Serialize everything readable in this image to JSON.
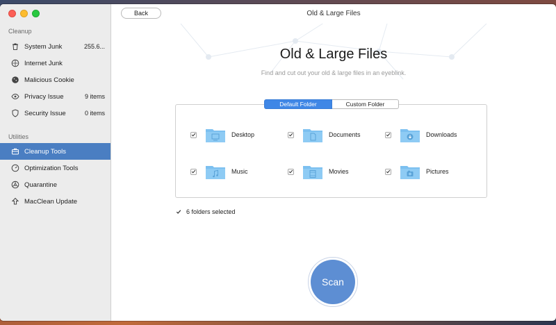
{
  "window": {
    "title": "Old & Large Files",
    "back_label": "Back"
  },
  "sidebar": {
    "cleanup_label": "Cleanup",
    "utilities_label": "Utilities",
    "cleanup_items": [
      {
        "label": "System Junk",
        "value": "255.6...",
        "icon": "trash-icon"
      },
      {
        "label": "Internet Junk",
        "value": "",
        "icon": "globe-icon"
      },
      {
        "label": "Malicious Cookie",
        "value": "",
        "icon": "cookie-icon"
      },
      {
        "label": "Privacy Issue",
        "value": "9 items",
        "icon": "eye-icon"
      },
      {
        "label": "Security Issue",
        "value": "0 items",
        "icon": "shield-icon"
      }
    ],
    "utility_items": [
      {
        "label": "Cleanup Tools",
        "icon": "toolbox-icon",
        "active": true
      },
      {
        "label": "Optimization Tools",
        "icon": "gauge-icon",
        "active": false
      },
      {
        "label": "Quarantine",
        "icon": "biohazard-icon",
        "active": false
      },
      {
        "label": "MacClean Update",
        "icon": "upload-arrow-icon",
        "active": false
      }
    ]
  },
  "main": {
    "title": "Old & Large Files",
    "subtitle": "Find and cut out your old & large files in an eyeblink.",
    "tabs": [
      {
        "label": "Default Folder",
        "selected": true
      },
      {
        "label": "Custom Folder",
        "selected": false
      }
    ],
    "folders": [
      {
        "name": "Desktop",
        "checked": true,
        "icon": "desktop-folder-icon"
      },
      {
        "name": "Documents",
        "checked": true,
        "icon": "documents-folder-icon"
      },
      {
        "name": "Downloads",
        "checked": true,
        "icon": "downloads-folder-icon"
      },
      {
        "name": "Music",
        "checked": true,
        "icon": "music-folder-icon"
      },
      {
        "name": "Movies",
        "checked": true,
        "icon": "movies-folder-icon"
      },
      {
        "name": "Pictures",
        "checked": true,
        "icon": "pictures-folder-icon"
      }
    ],
    "selected_text": "6 folders selected",
    "scan_label": "Scan"
  },
  "colors": {
    "accent": "#4a7ec2",
    "segment_on": "#3f87e6",
    "scan": "#5d8ed3",
    "folder": "#7cc0f0"
  }
}
